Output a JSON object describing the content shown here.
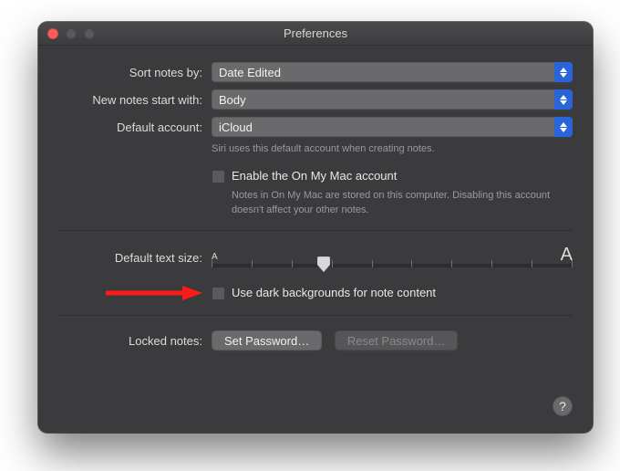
{
  "window": {
    "title": "Preferences"
  },
  "form": {
    "sort_label": "Sort notes by:",
    "sort_value": "Date Edited",
    "new_notes_label": "New notes start with:",
    "new_notes_value": "Body",
    "default_account_label": "Default account:",
    "default_account_value": "iCloud",
    "default_account_hint": "Siri uses this default account when creating notes.",
    "enable_onmymac_label": "Enable the On My Mac account",
    "enable_onmymac_hint": "Notes in On My Mac are stored on this computer. Disabling this account doesn't affect your other notes.",
    "default_text_size_label": "Default text size:",
    "text_size_min_glyph": "A",
    "text_size_max_glyph": "A",
    "dark_bg_label": "Use dark backgrounds for note content",
    "locked_label": "Locked notes:",
    "set_password_label": "Set Password…",
    "reset_password_label": "Reset Password…",
    "help_glyph": "?"
  }
}
